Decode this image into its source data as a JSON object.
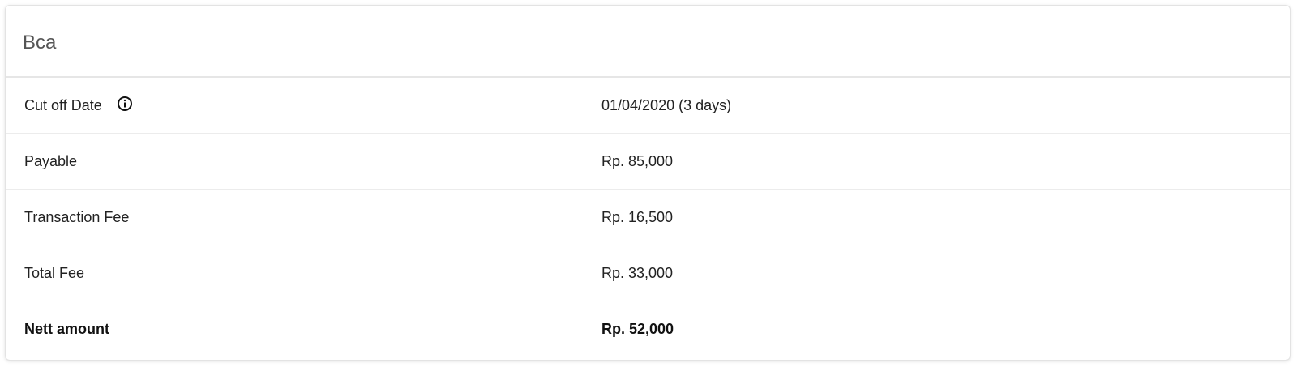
{
  "card": {
    "title": "Bca"
  },
  "rows": [
    {
      "label": "Cut off Date",
      "value": "01/04/2020 (3 days)",
      "icon": "info-icon"
    },
    {
      "label": "Payable",
      "value": "Rp. 85,000"
    },
    {
      "label": "Transaction Fee",
      "value": "Rp. 16,500"
    },
    {
      "label": "Total Fee",
      "value": "Rp. 33,000"
    },
    {
      "label": "Nett amount",
      "value": "Rp. 52,000",
      "emphasis": "bold"
    }
  ],
  "colors": {
    "title": "#555555",
    "text": "#222222",
    "divider": "#ececec"
  }
}
